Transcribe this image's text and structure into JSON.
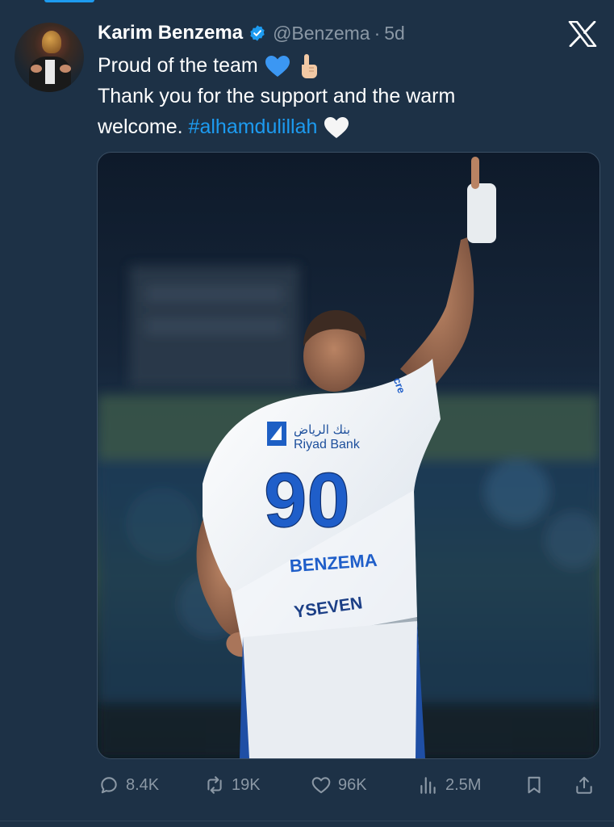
{
  "tweet": {
    "author_name": "Karim Benzema",
    "handle": "@Benzema",
    "separator": "·",
    "age": "5d",
    "text_line1": "Proud of the team",
    "text_line2": "Thank you for the support and the warm",
    "text_line3_prefix": "welcome. ",
    "hashtag": "#alhamdulillah",
    "icons": [
      "verified-badge-icon",
      "x-logo-icon",
      "blue-heart-emoji",
      "pointing-up-emoji",
      "white-heart-emoji"
    ]
  },
  "media": {
    "sponsor_arabic": "بنك الرياض",
    "sponsor": "Riyad Bank",
    "shirt_number": "90",
    "shirt_name": "BENZEMA",
    "back_sponsor": "YSEVEN",
    "sleeve_text": "cre"
  },
  "actions": {
    "replies": "8.4K",
    "reposts": "19K",
    "likes": "96K",
    "views": "2.5M",
    "icons": [
      "reply-icon",
      "repost-icon",
      "like-icon",
      "views-icon",
      "bookmark-icon",
      "share-icon"
    ]
  },
  "colors": {
    "background": "#1d3146",
    "accent": "#1d9bf0",
    "secondary_text": "#8b98a5"
  }
}
